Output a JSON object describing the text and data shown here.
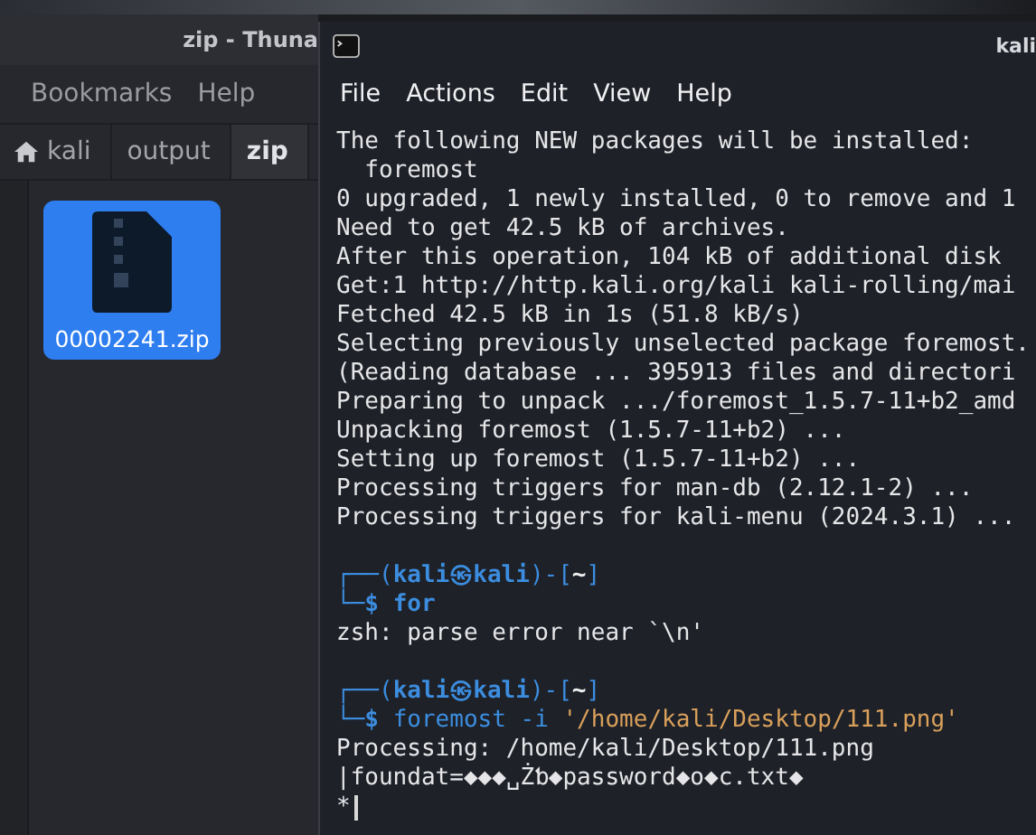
{
  "file_manager": {
    "title": "zip - Thuna",
    "menu": [
      "Bookmarks",
      "Help"
    ],
    "path": [
      {
        "label": "kali",
        "kind": "home",
        "selected": false
      },
      {
        "label": "output",
        "kind": "folder",
        "selected": false
      },
      {
        "label": "zip",
        "kind": "folder",
        "selected": true
      }
    ],
    "files": [
      {
        "name": "00002241.zip",
        "selected": true
      }
    ]
  },
  "terminal": {
    "title": "kali",
    "menu": [
      "File",
      "Actions",
      "Edit",
      "View",
      "Help"
    ],
    "cursor": true,
    "blocks": [
      [
        [
          {
            "kind": "out",
            "text": "The following NEW packages will be installed:"
          }
        ],
        [
          {
            "kind": "out",
            "text": "  foremost"
          }
        ],
        [
          {
            "kind": "out",
            "text": "0 upgraded, 1 newly installed, 0 to remove and 1"
          }
        ],
        [
          {
            "kind": "out",
            "text": "Need to get 42.5 kB of archives."
          }
        ],
        [
          {
            "kind": "out",
            "text": "After this operation, 104 kB of additional disk"
          }
        ],
        [
          {
            "kind": "out",
            "text": "Get:1 http://http.kali.org/kali kali-rolling/mai"
          }
        ],
        [
          {
            "kind": "out",
            "text": "Fetched 42.5 kB in 1s (51.8 kB/s)"
          }
        ],
        [
          {
            "kind": "out",
            "text": "Selecting previously unselected package foremost."
          }
        ],
        [
          {
            "kind": "out",
            "text": "(Reading database ... 395913 files and directori"
          }
        ],
        [
          {
            "kind": "out",
            "text": "Preparing to unpack .../foremost_1.5.7-11+b2_amd"
          }
        ],
        [
          {
            "kind": "out",
            "text": "Unpacking foremost (1.5.7-11+b2) ..."
          }
        ],
        [
          {
            "kind": "out",
            "text": "Setting up foremost (1.5.7-11+b2) ..."
          }
        ],
        [
          {
            "kind": "out",
            "text": "Processing triggers for man-db (2.12.1-2) ..."
          }
        ],
        [
          {
            "kind": "out",
            "text": "Processing triggers for kali-menu (2024.3.1) ..."
          }
        ]
      ],
      [
        [
          {
            "kind": "frame",
            "text": "┌──("
          },
          {
            "kind": "user",
            "text": "kali㉿kali"
          },
          {
            "kind": "frame",
            "text": ")-["
          },
          {
            "kind": "dir",
            "text": "~"
          },
          {
            "kind": "frame",
            "text": "]"
          }
        ],
        [
          {
            "kind": "frame",
            "text": "└─"
          },
          {
            "kind": "dollar",
            "text": "$ "
          },
          {
            "kind": "cmd",
            "text": "for"
          }
        ],
        [
          {
            "kind": "out",
            "text": "zsh: parse error near `\\n'"
          }
        ]
      ],
      [
        [
          {
            "kind": "frame",
            "text": "┌──("
          },
          {
            "kind": "user",
            "text": "kali㉿kali"
          },
          {
            "kind": "frame",
            "text": ")-["
          },
          {
            "kind": "dir",
            "text": "~"
          },
          {
            "kind": "frame",
            "text": "]"
          }
        ],
        [
          {
            "kind": "frame",
            "text": "└─"
          },
          {
            "kind": "dollar",
            "text": "$ "
          },
          {
            "kind": "arg",
            "text": "foremost -i "
          },
          {
            "kind": "string",
            "text": "'/home/kali/Desktop/111.png'"
          }
        ],
        [
          {
            "kind": "out",
            "text": "Processing: /home/kali/Desktop/111.png"
          }
        ],
        [
          {
            "kind": "out",
            "text": "|foundat=◆◆◆␣Żƅ◆password◆o◆c.txt◆"
          }
        ],
        [
          {
            "kind": "out",
            "text": "*"
          }
        ]
      ]
    ]
  }
}
